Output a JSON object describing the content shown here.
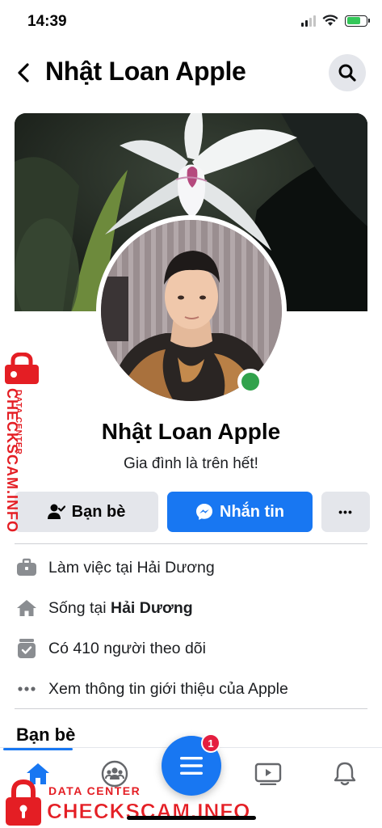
{
  "status_bar": {
    "time": "14:39"
  },
  "header": {
    "title": "Nhật Loan Apple"
  },
  "profile": {
    "name": "Nhật Loan Apple",
    "bio": "Gia đình là trên hết!"
  },
  "actions": {
    "friends_label": "Bạn bè",
    "message_label": "Nhắn tin",
    "more_label": "•••"
  },
  "info": {
    "work": "Làm việc tại Hải Dương",
    "lives_prefix": "Sống tại ",
    "lives_place": "Hải Dương",
    "followers": "Có 410 người theo dõi",
    "about": "Xem thông tin giới thiệu của Apple"
  },
  "friends_section": {
    "title": "Bạn bè"
  },
  "tab_bar": {
    "menu_badge": "1",
    "tabs": [
      "home-icon",
      "groups-icon",
      "menu-icon",
      "watch-icon",
      "notifications-icon"
    ]
  },
  "watermark": {
    "sub": "DATA CENTER",
    "main": "CHECKSCAM.INFO"
  },
  "colors": {
    "accent": "#1877f2",
    "online": "#31a24c",
    "badge": "#e41e3f",
    "watermark": "#e41e24"
  }
}
